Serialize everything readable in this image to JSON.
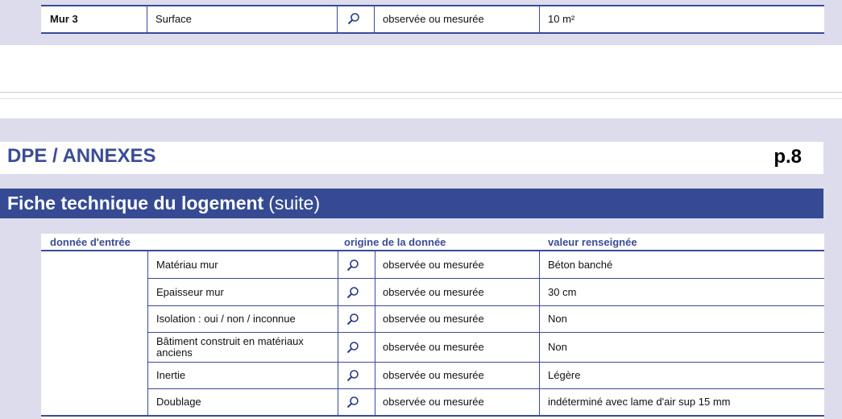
{
  "top_table": {
    "row": {
      "group": "Mur 3",
      "label": "Surface",
      "origin": "observée ou mesurée",
      "value": "10 m²"
    }
  },
  "page": {
    "title": "DPE / ANNEXES",
    "number": "p.8"
  },
  "section": {
    "title": "Fiche technique du logement",
    "suffix": "(suite)"
  },
  "columns": {
    "input": "donnée d'entrée",
    "origin": "origine de la donnée",
    "value": "valeur renseignée"
  },
  "rows": [
    {
      "label": "Matériau mur",
      "origin": "observée ou mesurée",
      "value": "Béton banché"
    },
    {
      "label": "Epaisseur mur",
      "origin": "observée ou mesurée",
      "value": "30 cm"
    },
    {
      "label": "Isolation : oui / non / inconnue",
      "origin": "observée ou mesurée",
      "value": "Non"
    },
    {
      "label": "Bâtiment construit en matériaux anciens",
      "origin": "observée ou mesurée",
      "value": "Non"
    },
    {
      "label": "Inertie",
      "origin": "observée ou mesurée",
      "value": "Légère"
    },
    {
      "label": "Doublage",
      "origin": "observée ou mesurée",
      "value": "indéterminé avec lame d'air sup 15 mm"
    }
  ],
  "colors": {
    "accent": "#354a93",
    "text_accent": "#3b4c96",
    "band": "#dcdcec"
  }
}
